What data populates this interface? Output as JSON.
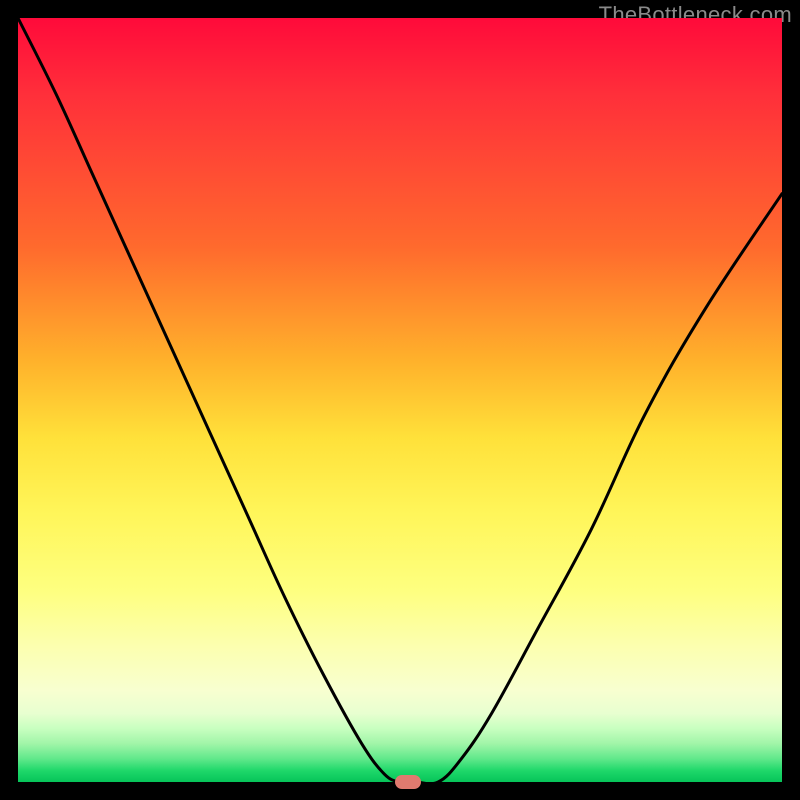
{
  "watermark": "TheBottleneck.com",
  "chart_data": {
    "type": "line",
    "title": "",
    "xlabel": "",
    "ylabel": "",
    "xlim": [
      0,
      100
    ],
    "ylim": [
      0,
      100
    ],
    "grid": false,
    "legend": false,
    "series": [
      {
        "name": "curve",
        "x": [
          0,
          5,
          10,
          15,
          20,
          25,
          30,
          35,
          40,
          45,
          48,
          50,
          52,
          55,
          58,
          62,
          68,
          75,
          82,
          90,
          100
        ],
        "values": [
          100,
          90,
          79,
          68,
          57,
          46,
          35,
          24,
          14,
          5,
          1,
          0,
          0,
          0,
          3,
          9,
          20,
          33,
          48,
          62,
          77
        ]
      }
    ],
    "marker": {
      "x": 51,
      "y": 0
    },
    "background_gradient": {
      "top": "#ff0a3a",
      "mid": "#ffe13a",
      "bottom": "#06c459"
    }
  }
}
